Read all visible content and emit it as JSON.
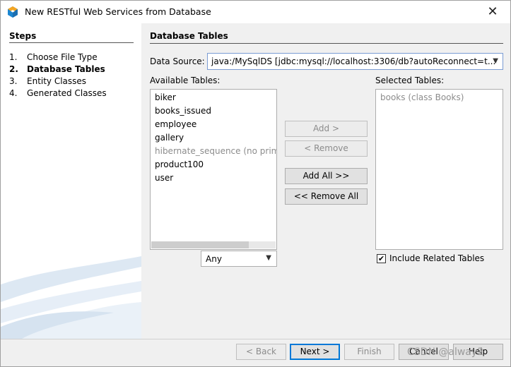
{
  "window": {
    "title": "New RESTful Web Services from Database"
  },
  "steps": {
    "title": "Steps",
    "items": [
      {
        "num": "1.",
        "label": "Choose File Type"
      },
      {
        "num": "2.",
        "label": "Database Tables"
      },
      {
        "num": "3.",
        "label": "Entity Classes"
      },
      {
        "num": "4.",
        "label": "Generated Classes"
      }
    ],
    "current_index": 1
  },
  "content": {
    "title": "Database Tables",
    "data_source_label": "Data Source:",
    "data_source_value": "java:/MySqlDS [jdbc:mysql://localhost:3306/db?autoReconnect=t...",
    "available_label": "Available Tables:",
    "selected_label": "Selected Tables:",
    "available_tables": [
      {
        "label": "biker",
        "enabled": true
      },
      {
        "label": "books_issued",
        "enabled": true
      },
      {
        "label": "employee",
        "enabled": true
      },
      {
        "label": "gallery",
        "enabled": true
      },
      {
        "label": "hibernate_sequence (no primary key)",
        "enabled": false
      },
      {
        "label": "product100",
        "enabled": true
      },
      {
        "label": "user",
        "enabled": true
      }
    ],
    "selected_tables": [
      {
        "label": "books (class Books)",
        "enabled": false
      }
    ],
    "filter_value": "Any",
    "buttons": {
      "add": "Add >",
      "remove": "< Remove",
      "add_all": "Add All >>",
      "remove_all": "<< Remove All"
    },
    "include_related_label": "Include Related Tables",
    "include_related_checked": true
  },
  "footer": {
    "back": "< Back",
    "next": "Next >",
    "finish": "Finish",
    "cancel": "Cancel",
    "help": "Help"
  },
  "watermark": "CSDN @alway2",
  "colors": {
    "accent": "#0078d7",
    "checkbox_check": "#000000",
    "disabled_text": "#8c8c8c"
  },
  "icons": {
    "app": "netbeans-cube-icon",
    "close": "close-icon",
    "dropdown": "chevron-down-icon",
    "check": "checkmark-icon"
  }
}
